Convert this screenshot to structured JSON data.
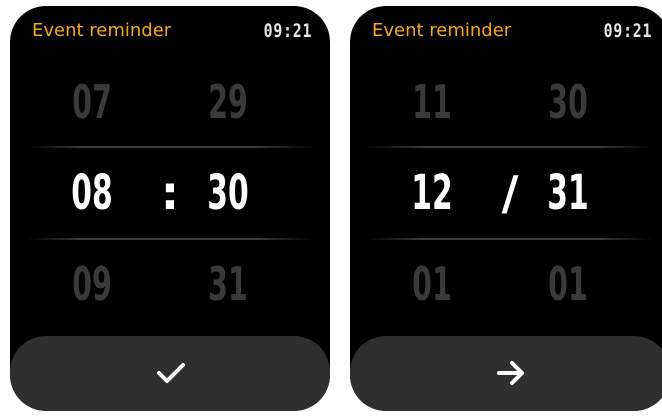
{
  "screens": [
    {
      "title": "Event reminder",
      "clock": "09:21",
      "separator": ":",
      "picker": {
        "left_top": "07",
        "right_top": "29",
        "left_selected": "08",
        "right_selected": "30",
        "left_bottom": "09",
        "right_bottom": "31"
      },
      "action_icon": "checkmark-icon"
    },
    {
      "title": "Event reminder",
      "clock": "09:21",
      "separator": "/",
      "picker": {
        "left_top": "11",
        "right_top": "30",
        "left_selected": "12",
        "right_selected": "31",
        "left_bottom": "01",
        "right_bottom": "01"
      },
      "action_icon": "arrow-right-icon"
    }
  ],
  "colors": {
    "title": "#f5a623",
    "clock": "#e6e6e6",
    "selected": "#ffffff",
    "dim": "#3a3a3a",
    "button_bg": "#2f2f2f",
    "screen_bg": "#000000"
  }
}
